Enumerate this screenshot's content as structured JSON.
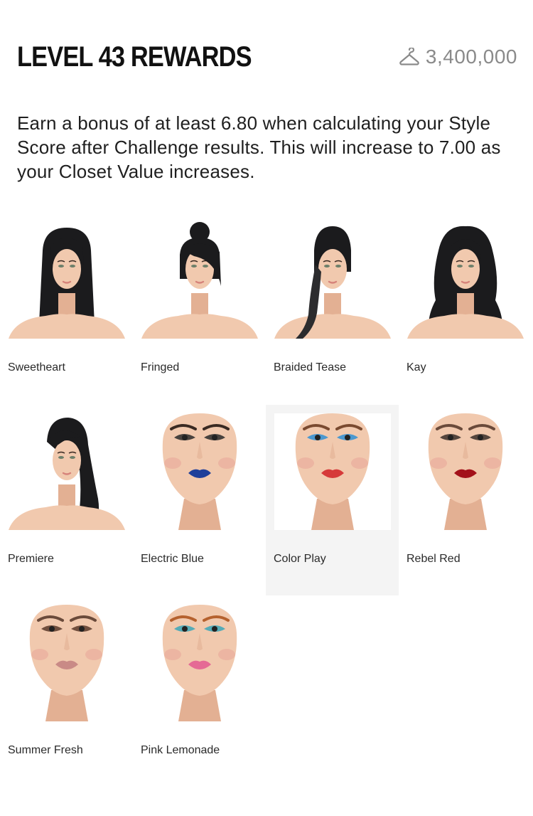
{
  "header": {
    "title": "LEVEL 43 REWARDS",
    "closet_value": "3,400,000",
    "closet_icon": "hanger-icon"
  },
  "description": "Earn a bonus of at least 6.80 when calculating your Style Score after Challenge results. This will increase to 7.00 as your Closet Value increases.",
  "rewards": [
    {
      "label": "Sweetheart",
      "kind": "hair",
      "style": "long-straight"
    },
    {
      "label": "Fringed",
      "kind": "hair",
      "style": "bun-fringe"
    },
    {
      "label": "Braided Tease",
      "kind": "hair",
      "style": "braid"
    },
    {
      "label": "Kay",
      "kind": "hair",
      "style": "wavy"
    },
    {
      "label": "Premiere",
      "kind": "hair",
      "style": "side-swept"
    },
    {
      "label": "Electric Blue",
      "kind": "makeup",
      "lip": "#1f3f9a",
      "eye": "#2a2a2a",
      "brow": "#3a2a22"
    },
    {
      "label": "Color Play",
      "kind": "makeup",
      "lip": "#d63a3a",
      "eye": "#2e8fd6",
      "brow": "#7a4a30",
      "selected": true
    },
    {
      "label": "Rebel Red",
      "kind": "makeup",
      "lip": "#a3111a",
      "eye": "#3a2f2a",
      "brow": "#6a4a3a"
    },
    {
      "label": "Summer Fresh",
      "kind": "makeup",
      "lip": "#c98a86",
      "eye": "#5a3a2a",
      "brow": "#6a4a3a"
    },
    {
      "label": "Pink Lemonade",
      "kind": "makeup",
      "lip": "#e56a95",
      "eye": "#3aa6b8",
      "brow": "#b5612e"
    }
  ]
}
